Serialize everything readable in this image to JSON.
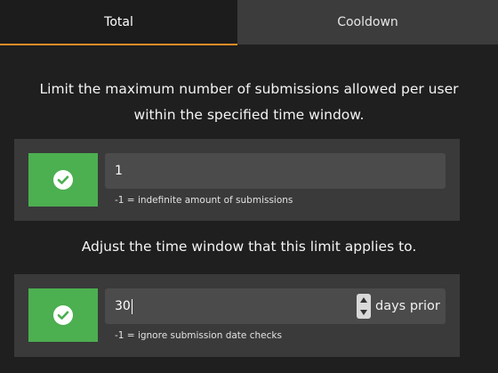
{
  "tabs": {
    "total_label": "Total",
    "cooldown_label": "Cooldown"
  },
  "limit_section": {
    "description_line1": "Limit the maximum number of submissions allowed per user",
    "description_line2": "within the specified time window.",
    "enabled": true,
    "value": "1",
    "hint": "-1 = indefinite amount of submissions"
  },
  "window_section": {
    "description": "Adjust the time window that this limit applies to.",
    "enabled": true,
    "value": "30",
    "suffix": "days prior",
    "hint": "-1 = ignore submission date checks"
  },
  "colors": {
    "accent": "#f28c28",
    "toggle_on": "#4caf50",
    "background": "#1f1f1f",
    "row_background": "#3a3a3a",
    "field_background": "#4b4b4b"
  },
  "icons": {
    "toggle": "check-circle-icon",
    "spinner": "spinner-arrows-icon"
  }
}
